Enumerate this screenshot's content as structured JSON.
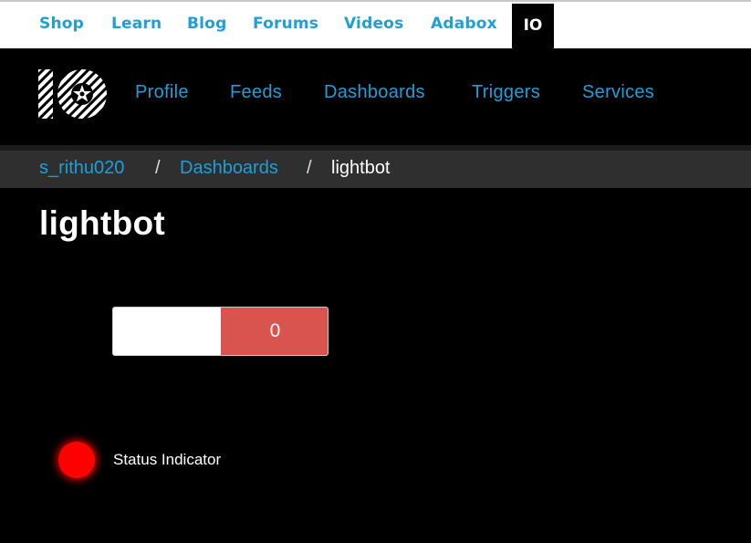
{
  "top_nav": {
    "links": [
      "Shop",
      "Learn",
      "Blog",
      "Forums",
      "Videos",
      "Adabox"
    ],
    "active_tab": "IO"
  },
  "io_nav": {
    "logo": "adafruit-io-logo",
    "links": [
      "Profile",
      "Feeds",
      "Dashboards",
      "Triggers",
      "Services"
    ]
  },
  "breadcrumb": {
    "user": "s_rithu020",
    "separator": "/",
    "section": "Dashboards",
    "current": "lightbot"
  },
  "page": {
    "title": "lightbot"
  },
  "toggle_block": {
    "value": "0",
    "on_color": "#d9534f",
    "off_color": "#ffffff"
  },
  "indicator_block": {
    "label": "Status Indicator",
    "color": "#ff0000"
  },
  "colors": {
    "link": "#1e9fd8",
    "background": "#000000",
    "breadcrumb_bar": "#2f2f2f"
  }
}
